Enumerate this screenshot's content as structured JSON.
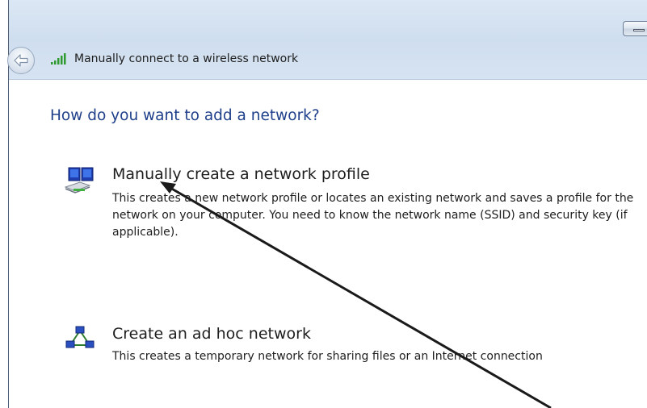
{
  "window": {
    "title": "Manually connect to a wireless network"
  },
  "page": {
    "heading": "How do you want to add a network?"
  },
  "options": [
    {
      "title": "Manually create a network profile",
      "description": "This creates a new network profile or locates an existing network and saves a profile for the network on your computer. You need to know the network name (SSID) and security key (if applicable).",
      "icon": "network-profile-icon"
    },
    {
      "title": "Create an ad hoc network",
      "description": "This creates a temporary network for sharing files or an Internet connection",
      "icon": "ad-hoc-network-icon"
    }
  ],
  "colors": {
    "heading": "#1e3f8a",
    "titlebar": "#d3e0f0",
    "annotation_arrow": "#1a1a1a"
  },
  "icons": {
    "back": "back-arrow-icon",
    "signal": "wireless-signal-icon",
    "minimize": "minimize-icon"
  }
}
